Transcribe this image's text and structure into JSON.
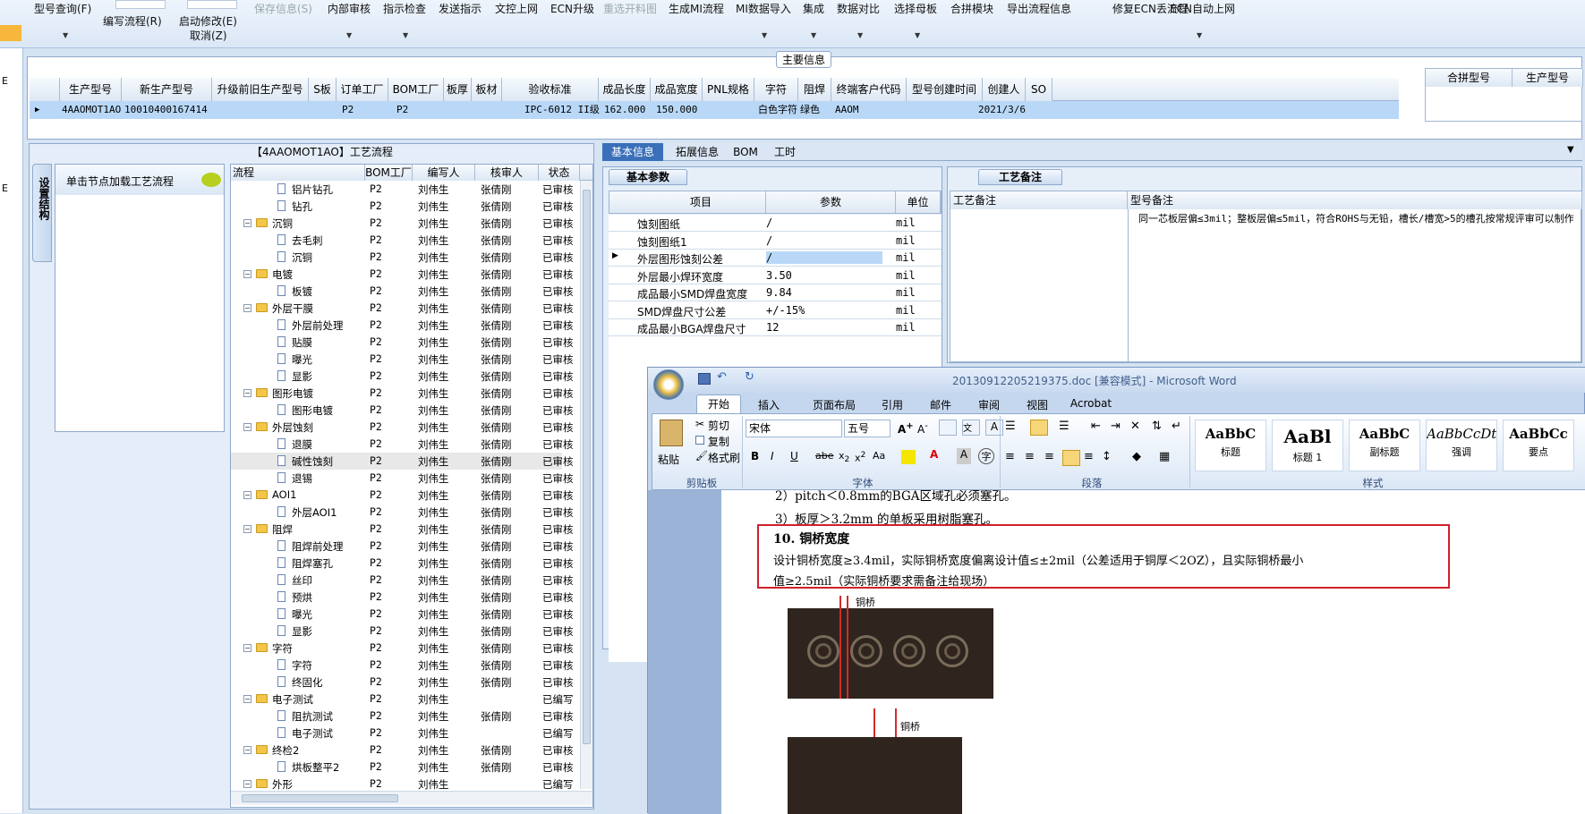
{
  "toolbar": {
    "items": [
      {
        "label": "型号查询(F)"
      },
      {
        "label": "编写流程(R)"
      },
      {
        "label": "启动修改(E)"
      },
      {
        "label": "取消(Z)"
      },
      {
        "label": "保存信息(S)"
      },
      {
        "label": "内部审核"
      },
      {
        "label": "指示检查"
      },
      {
        "label": "发送指示"
      },
      {
        "label": "文控上网"
      },
      {
        "label": "ECN升级"
      },
      {
        "label": "重选开料图"
      },
      {
        "label": "生成MI流程"
      },
      {
        "label": "MI数据导入"
      },
      {
        "label": "集成"
      },
      {
        "label": "数据对比"
      },
      {
        "label": "选择母板"
      },
      {
        "label": "合拼模块"
      },
      {
        "label": "导出流程信息"
      },
      {
        "label": "修复ECN丢流程"
      },
      {
        "label": "ECN自动上网"
      }
    ]
  },
  "left_edge": {
    "label1": "E",
    "label2": "E"
  },
  "main_info": {
    "title": "主要信息",
    "columns": [
      "生产型号",
      "新生产型号",
      "升级前旧生产型号",
      "S板",
      "订单工厂",
      "BOM工厂",
      "板厚",
      "板材",
      "验收标准",
      "成品长度",
      "成品宽度",
      "PNL规格",
      "字符",
      "阻焊",
      "终端客户代码",
      "型号创建时间",
      "创建人",
      "SO"
    ],
    "row": [
      "4AAOMOT1AO",
      "10010400167414",
      "",
      "",
      "P2",
      "P2",
      "",
      "",
      "IPC-6012 II级",
      "162.000",
      "150.000",
      "",
      "白色字符",
      "绿色",
      "AAOM",
      "2021/3/6",
      "",
      ""
    ],
    "side_columns": [
      "合拼型号",
      "生产型号"
    ]
  },
  "process_panel": {
    "title": "【4AAOMOT1AO】工艺流程",
    "side_tab": "设置结构",
    "node_hint": "单击节点加载工艺流程",
    "columns": [
      "流程",
      "BOM工厂",
      "编写人",
      "核审人",
      "状态"
    ],
    "rows": [
      {
        "name": "铝片钻孔",
        "level": 2,
        "type": "doc",
        "bom": "P2",
        "writer": "刘伟生",
        "reviewer": "张倩刚",
        "status": "已审核"
      },
      {
        "name": "钻孔",
        "level": 2,
        "type": "doc",
        "bom": "P2",
        "writer": "刘伟生",
        "reviewer": "张倩刚",
        "status": "已审核"
      },
      {
        "name": "沉铜",
        "level": 1,
        "type": "folder",
        "bom": "P2",
        "writer": "刘伟生",
        "reviewer": "张倩刚",
        "status": "已审核"
      },
      {
        "name": "去毛刺",
        "level": 2,
        "type": "doc",
        "bom": "P2",
        "writer": "刘伟生",
        "reviewer": "张倩刚",
        "status": "已审核"
      },
      {
        "name": "沉铜",
        "level": 2,
        "type": "doc",
        "bom": "P2",
        "writer": "刘伟生",
        "reviewer": "张倩刚",
        "status": "已审核"
      },
      {
        "name": "电镀",
        "level": 1,
        "type": "folder",
        "bom": "P2",
        "writer": "刘伟生",
        "reviewer": "张倩刚",
        "status": "已审核"
      },
      {
        "name": "板镀",
        "level": 2,
        "type": "doc",
        "bom": "P2",
        "writer": "刘伟生",
        "reviewer": "张倩刚",
        "status": "已审核"
      },
      {
        "name": "外层干膜",
        "level": 1,
        "type": "folder",
        "bom": "P2",
        "writer": "刘伟生",
        "reviewer": "张倩刚",
        "status": "已审核"
      },
      {
        "name": "外层前处理",
        "level": 2,
        "type": "doc",
        "bom": "P2",
        "writer": "刘伟生",
        "reviewer": "张倩刚",
        "status": "已审核"
      },
      {
        "name": "贴膜",
        "level": 2,
        "type": "doc",
        "bom": "P2",
        "writer": "刘伟生",
        "reviewer": "张倩刚",
        "status": "已审核"
      },
      {
        "name": "曝光",
        "level": 2,
        "type": "doc",
        "bom": "P2",
        "writer": "刘伟生",
        "reviewer": "张倩刚",
        "status": "已审核"
      },
      {
        "name": "显影",
        "level": 2,
        "type": "doc",
        "bom": "P2",
        "writer": "刘伟生",
        "reviewer": "张倩刚",
        "status": "已审核"
      },
      {
        "name": "图形电镀",
        "level": 1,
        "type": "folder",
        "bom": "P2",
        "writer": "刘伟生",
        "reviewer": "张倩刚",
        "status": "已审核"
      },
      {
        "name": "图形电镀",
        "level": 2,
        "type": "doc",
        "bom": "P2",
        "writer": "刘伟生",
        "reviewer": "张倩刚",
        "status": "已审核"
      },
      {
        "name": "外层蚀刻",
        "level": 1,
        "type": "folder",
        "bom": "P2",
        "writer": "刘伟生",
        "reviewer": "张倩刚",
        "status": "已审核"
      },
      {
        "name": "退膜",
        "level": 2,
        "type": "doc",
        "bom": "P2",
        "writer": "刘伟生",
        "reviewer": "张倩刚",
        "status": "已审核"
      },
      {
        "name": "碱性蚀刻",
        "level": 2,
        "type": "doc",
        "bom": "P2",
        "writer": "刘伟生",
        "reviewer": "张倩刚",
        "status": "已审核",
        "selected": true
      },
      {
        "name": "退锡",
        "level": 2,
        "type": "doc",
        "bom": "P2",
        "writer": "刘伟生",
        "reviewer": "张倩刚",
        "status": "已审核"
      },
      {
        "name": "AOI1",
        "level": 1,
        "type": "folder",
        "bom": "P2",
        "writer": "刘伟生",
        "reviewer": "张倩刚",
        "status": "已审核"
      },
      {
        "name": "外层AOI1",
        "level": 2,
        "type": "doc",
        "bom": "P2",
        "writer": "刘伟生",
        "reviewer": "张倩刚",
        "status": "已审核"
      },
      {
        "name": "阻焊",
        "level": 1,
        "type": "folder",
        "bom": "P2",
        "writer": "刘伟生",
        "reviewer": "张倩刚",
        "status": "已审核"
      },
      {
        "name": "阻焊前处理",
        "level": 2,
        "type": "doc",
        "bom": "P2",
        "writer": "刘伟生",
        "reviewer": "张倩刚",
        "status": "已审核"
      },
      {
        "name": "阻焊塞孔",
        "level": 2,
        "type": "doc",
        "bom": "P2",
        "writer": "刘伟生",
        "reviewer": "张倩刚",
        "status": "已审核"
      },
      {
        "name": "丝印",
        "level": 2,
        "type": "doc",
        "bom": "P2",
        "writer": "刘伟生",
        "reviewer": "张倩刚",
        "status": "已审核"
      },
      {
        "name": "预烘",
        "level": 2,
        "type": "doc",
        "bom": "P2",
        "writer": "刘伟生",
        "reviewer": "张倩刚",
        "status": "已审核"
      },
      {
        "name": "曝光",
        "level": 2,
        "type": "doc",
        "bom": "P2",
        "writer": "刘伟生",
        "reviewer": "张倩刚",
        "status": "已审核"
      },
      {
        "name": "显影",
        "level": 2,
        "type": "doc",
        "bom": "P2",
        "writer": "刘伟生",
        "reviewer": "张倩刚",
        "status": "已审核"
      },
      {
        "name": "字符",
        "level": 1,
        "type": "folder",
        "bom": "P2",
        "writer": "刘伟生",
        "reviewer": "张倩刚",
        "status": "已审核"
      },
      {
        "name": "字符",
        "level": 2,
        "type": "doc",
        "bom": "P2",
        "writer": "刘伟生",
        "reviewer": "张倩刚",
        "status": "已审核"
      },
      {
        "name": "终固化",
        "level": 2,
        "type": "doc",
        "bom": "P2",
        "writer": "刘伟生",
        "reviewer": "张倩刚",
        "status": "已审核"
      },
      {
        "name": "电子测试",
        "level": 1,
        "type": "folder",
        "bom": "P2",
        "writer": "刘伟生",
        "reviewer": "",
        "status": "已编写"
      },
      {
        "name": "阻抗测试",
        "level": 2,
        "type": "doc",
        "bom": "P2",
        "writer": "刘伟生",
        "reviewer": "张倩刚",
        "status": "已审核"
      },
      {
        "name": "电子测试",
        "level": 2,
        "type": "doc",
        "bom": "P2",
        "writer": "刘伟生",
        "reviewer": "",
        "status": "已编写"
      },
      {
        "name": "终检2",
        "level": 1,
        "type": "folder",
        "bom": "P2",
        "writer": "刘伟生",
        "reviewer": "张倩刚",
        "status": "已审核"
      },
      {
        "name": "烘板整平2",
        "level": 2,
        "type": "doc",
        "bom": "P2",
        "writer": "刘伟生",
        "reviewer": "张倩刚",
        "status": "已审核"
      },
      {
        "name": "外形",
        "level": 1,
        "type": "folder",
        "bom": "P2",
        "writer": "刘伟生",
        "reviewer": "",
        "status": "已编写"
      }
    ]
  },
  "right_tabs": [
    "基本信息",
    "拓展信息",
    "BOM",
    "工时"
  ],
  "basic_params": {
    "tab": "基本参数",
    "columns": [
      "项目",
      "参数",
      "单位"
    ],
    "rows": [
      {
        "item": "蚀刻图纸",
        "value": "/",
        "unit": "mil"
      },
      {
        "item": "蚀刻图纸1",
        "value": "/",
        "unit": "mil"
      },
      {
        "item": "外层图形蚀刻公差",
        "value": "/",
        "unit": "mil"
      },
      {
        "item": "外层最小焊环宽度",
        "value": "3.50",
        "unit": "mil"
      },
      {
        "item": "成品最小SMD焊盘宽度",
        "value": "9.84",
        "unit": "mil"
      },
      {
        "item": "SMD焊盘尺寸公差",
        "value": "+/-15%",
        "unit": "mil"
      },
      {
        "item": "成品最小BGA焊盘尺寸",
        "value": "12",
        "unit": "mil"
      }
    ]
  },
  "process_remarks": {
    "tab": "工艺备注",
    "col1": "工艺备注",
    "col2": "型号备注",
    "remark": "同一芯板层偏≤3mil；整板层偏≤5mil，符合ROHS与无铅，槽长/槽宽>5的槽孔按常规评审可以制作"
  },
  "word": {
    "title": "20130912205219375.doc [兼容模式] - Microsoft Word",
    "tabs": [
      "开始",
      "插入",
      "页面布局",
      "引用",
      "邮件",
      "审阅",
      "视图",
      "Acrobat"
    ],
    "clipboard": {
      "paste": "粘贴",
      "cut": "剪切",
      "copy": "复制",
      "format": "格式刷",
      "label": "剪贴板"
    },
    "font": {
      "name": "宋体",
      "size": "五号",
      "label": "字体"
    },
    "paragraph_label": "段落",
    "styles": [
      {
        "sample": "AaBbC",
        "name": "标题"
      },
      {
        "sample": "AaBl",
        "name": "标题 1"
      },
      {
        "sample": "AaBbC",
        "name": "副标题"
      },
      {
        "sample": "AaBbCcDt",
        "name": "强调"
      },
      {
        "sample": "AaBbCc",
        "name": "要点"
      }
    ],
    "styles_label": "样式",
    "doc": {
      "line_cut": "2）pitch＜0.8mm的BGA区域孔必须塞孔。",
      "line2": "3）板厚＞3.2mm 的单板采用树脂塞孔。",
      "heading": "10. 铜桥宽度",
      "para1": "设计铜桥宽度≥3.4mil，实际铜桥宽度偏离设计值≤±2mil（公差适用于铜厚＜2OZ），且实际铜桥最小",
      "para2": "值≥2.5mil（实际铜桥要求需备注给现场）",
      "fig_label": "铜桥",
      "fig_label2": "铜桥"
    },
    "colors": {
      "highlight_box": "#d0202a"
    }
  }
}
